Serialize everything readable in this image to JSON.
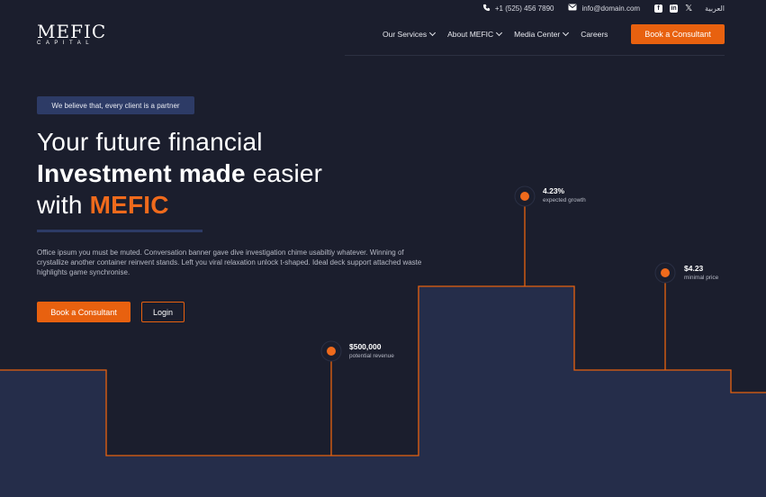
{
  "topbar": {
    "phone": "+1 (525) 456 7890",
    "email": "info@domain.com",
    "social": [
      "facebook-icon",
      "linkedin-icon",
      "x-icon"
    ],
    "language": "العربية"
  },
  "logo": {
    "line1": "MEFIC",
    "line2": "CAPITAL"
  },
  "nav": {
    "items": [
      "Our Services",
      "About MEFIC",
      "Media Center",
      "Careers"
    ],
    "cta": "Book a Consultant"
  },
  "hero": {
    "tagline": "We believe that, every client is a partner",
    "line1": "Your future financial",
    "line2_bold": "Investment made",
    "line2_rest": " easier",
    "line3_prefix": "with ",
    "line3_accent": "MEFIC",
    "description": "Office ipsum you must be muted. Conversation banner gave dive investigation chime usabiltiy whatever. Winning of crystallize another container reinvent stands. Left you viral relaxation unlock t-shaped. Ideal deck support attached waste highlights game synchronise.",
    "primary_button": "Book a Consultant",
    "secondary_button": "Login"
  },
  "stats": [
    {
      "value": "$500,000",
      "label": "potential revenue"
    },
    {
      "value": "4.23%",
      "label": "expected growth"
    },
    {
      "value": "$4.23",
      "label": "minimal price"
    }
  ],
  "colors": {
    "accent": "#e8610f",
    "background": "#1b1e2d",
    "panel": "#252d4a",
    "tag": "#2d3b66"
  }
}
